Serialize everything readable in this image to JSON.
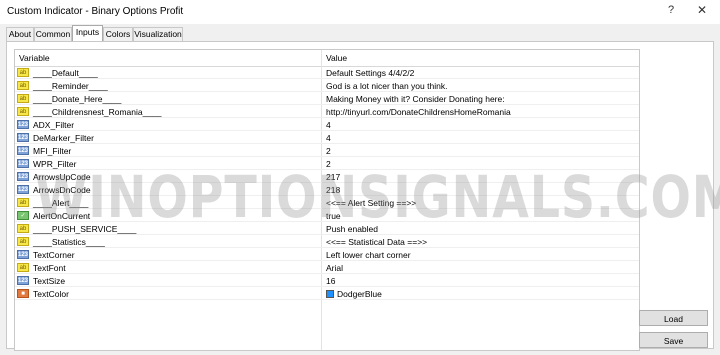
{
  "window": {
    "title": "Custom Indicator - Binary Options Profit",
    "help_label": "?",
    "close_label": "✕"
  },
  "tabs": [
    {
      "label": "About"
    },
    {
      "label": "Common"
    },
    {
      "label": "Inputs"
    },
    {
      "label": "Colors"
    },
    {
      "label": "Visualization"
    }
  ],
  "active_tab": "Inputs",
  "grid": {
    "headers": {
      "variable": "Variable",
      "value": "Value"
    },
    "rows": [
      {
        "icon": "ab",
        "variable": "____Default____",
        "value": "Default Settings 4/4/2/2"
      },
      {
        "icon": "ab",
        "variable": "____Reminder____",
        "value": "God is a lot nicer than you think."
      },
      {
        "icon": "ab",
        "variable": "____Donate_Here____",
        "value": "Making Money with it? Consider Donating here:"
      },
      {
        "icon": "ab",
        "variable": "____Childrensnest_Romania____",
        "value": "http://tinyurl.com/DonateChildrensHomeRomania"
      },
      {
        "icon": "123",
        "variable": "ADX_Filter",
        "value": "4"
      },
      {
        "icon": "123",
        "variable": "DeMarker_Filter",
        "value": "4"
      },
      {
        "icon": "123",
        "variable": "MFI_Filter",
        "value": "2"
      },
      {
        "icon": "123",
        "variable": "WPR_Filter",
        "value": "2"
      },
      {
        "icon": "123",
        "variable": "ArrowsUpCode",
        "value": "217"
      },
      {
        "icon": "123",
        "variable": "ArrowsDnCode",
        "value": "218"
      },
      {
        "icon": "ab",
        "variable": "____Alert____",
        "value": "<<== Alert Setting ==>>"
      },
      {
        "icon": "bool",
        "variable": "AlertOnCurrent",
        "value": "true"
      },
      {
        "icon": "ab",
        "variable": "____PUSH_SERVICE____",
        "value": "Push enabled"
      },
      {
        "icon": "ab",
        "variable": "____Statistics____",
        "value": "<<== Statistical Data ==>>"
      },
      {
        "icon": "123",
        "variable": "TextCorner",
        "value": "Left lower chart corner"
      },
      {
        "icon": "ab",
        "variable": "TextFont",
        "value": "Arial"
      },
      {
        "icon": "123",
        "variable": "TextSize",
        "value": "16"
      },
      {
        "icon": "color",
        "variable": "TextColor",
        "value": "DodgerBlue",
        "swatch": "#1e90ff"
      }
    ]
  },
  "watermark": "WINOPTIONSIGNALS.COM",
  "buttons": {
    "load": "Load",
    "save": "Save"
  }
}
